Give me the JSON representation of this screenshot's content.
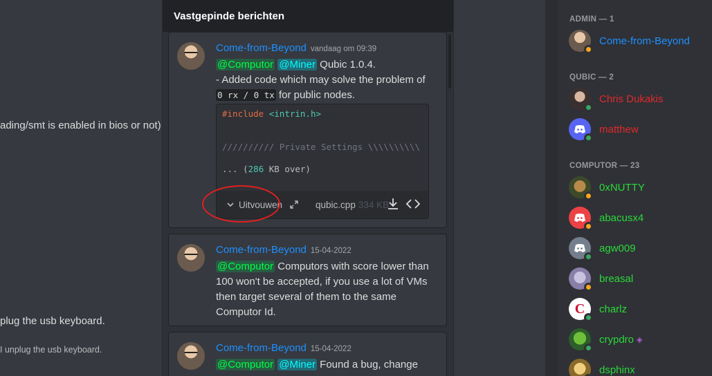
{
  "left_fragments": {
    "line1": "ading/smt is enabled in bios or not)",
    "line2": "plug the usb keyboard.",
    "line3": "I unplug the usb keyboard."
  },
  "pins": {
    "title": "Vastgepinde berichten",
    "messages": [
      {
        "author": "Come-from-Beyond",
        "time": "vandaag om 09:39",
        "mention1": "@Computor",
        "mention2": "@Miner",
        "text1": "Qubic 1.0.4.",
        "text2": "- Added code which may solve the problem of",
        "code_a": "0 rx / 0 tx",
        "text3": "for public nodes.",
        "file": {
          "include_kw": "#include",
          "include_str": "<intrin.h>",
          "comment": "////////// Private Settings \\\\\\\\\\\\\\\\\\\\",
          "more_prefix": "... (",
          "more_num": "286",
          "more_suffix": " KB over)",
          "expand_label": "Uitvouwen",
          "name": "qubic.cpp",
          "size": "334 KB"
        }
      },
      {
        "author": "Come-from-Beyond",
        "time": "15-04-2022",
        "mention1": "@Computor",
        "text": "Computors with score lower than 100 won't be accepted, if you use a lot of VMs then target several of them to the same Computor Id."
      },
      {
        "author": "Come-from-Beyond",
        "time": "15-04-2022",
        "mention1": "@Computor",
        "mention2": "@Miner",
        "text": "Found a bug, change"
      }
    ]
  },
  "members": {
    "categories": [
      {
        "label": "ADMIN — 1"
      },
      {
        "label": "QUBIC — 2"
      },
      {
        "label": "COMPUTOR — 23"
      }
    ],
    "list": [
      {
        "name": "Come-from-Beyond",
        "color": "#1e90ff",
        "status": "idle"
      },
      {
        "name": "Chris Dukakis",
        "color": "#e02a2a",
        "status": "online"
      },
      {
        "name": "matthew",
        "color": "#e02a2a",
        "status": "online"
      },
      {
        "name": "0xNUTTY",
        "color": "#2bd93a",
        "status": "idle"
      },
      {
        "name": "abacusx4",
        "color": "#2bd93a",
        "status": "idle"
      },
      {
        "name": "agw009",
        "color": "#2bd93a",
        "status": "online"
      },
      {
        "name": "breasal",
        "color": "#2bd93a",
        "status": "idle"
      },
      {
        "name": "charlz",
        "color": "#2bd93a",
        "status": "online"
      },
      {
        "name": "crypdro",
        "color": "#2bd93a",
        "status": "online"
      },
      {
        "name": "dsphinx",
        "color": "#2bd93a",
        "status": "online"
      }
    ]
  }
}
